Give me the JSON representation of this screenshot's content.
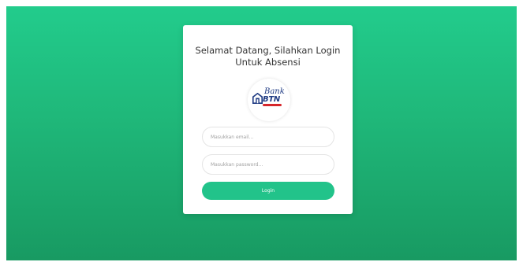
{
  "login": {
    "title_line1": "Selamat Datang, Silahkan Login",
    "title_line2": "Untuk Absensi",
    "logo": {
      "icon": "btn-bank-logo",
      "text_top": "Bank",
      "text_bottom": "BTN"
    },
    "email_placeholder": "Masukkan email...",
    "password_placeholder": "Masukkan password...",
    "login_label": "Login"
  },
  "colors": {
    "background_top": "#22cc8c",
    "background_bottom": "#189a62",
    "button": "#22c38a",
    "logo_blue": "#1f3b83",
    "logo_red": "#d6262b"
  }
}
